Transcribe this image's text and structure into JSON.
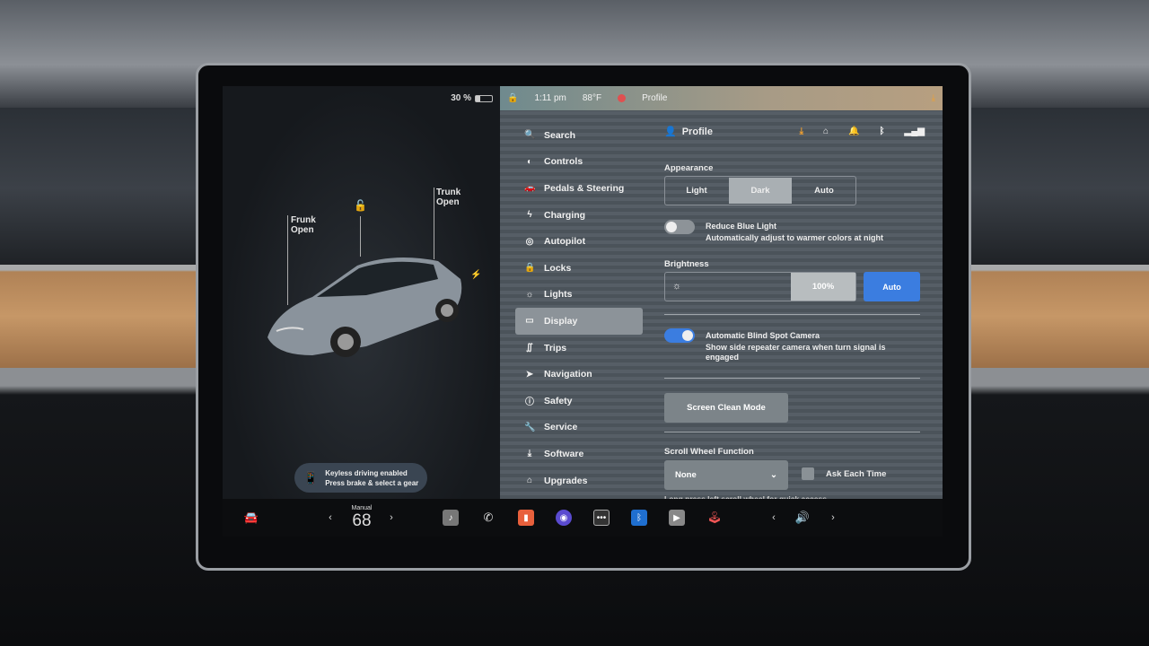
{
  "status": {
    "battery": "30 %",
    "battery_level": 30,
    "time": "1:11 pm",
    "temperature": "88°F",
    "profile": "Profile"
  },
  "car": {
    "frunk": "Frunk\nOpen",
    "trunk": "Trunk\nOpen"
  },
  "toast": {
    "title": "Keyless driving enabled",
    "subtitle": "Press brake & select a gear"
  },
  "menu": [
    {
      "label": "Search",
      "icon": "search-icon"
    },
    {
      "label": "Controls",
      "icon": "toggle-icon"
    },
    {
      "label": "Pedals & Steering",
      "icon": "car-icon"
    },
    {
      "label": "Charging",
      "icon": "bolt-icon"
    },
    {
      "label": "Autopilot",
      "icon": "steering-wheel-icon"
    },
    {
      "label": "Locks",
      "icon": "lock-icon"
    },
    {
      "label": "Lights",
      "icon": "sun-icon"
    },
    {
      "label": "Display",
      "icon": "display-icon",
      "selected": true
    },
    {
      "label": "Trips",
      "icon": "trips-icon"
    },
    {
      "label": "Navigation",
      "icon": "navigation-icon"
    },
    {
      "label": "Safety",
      "icon": "safety-icon"
    },
    {
      "label": "Service",
      "icon": "wrench-icon"
    },
    {
      "label": "Software",
      "icon": "download-icon"
    },
    {
      "label": "Upgrades",
      "icon": "bag-icon"
    }
  ],
  "header": {
    "profile": "Profile"
  },
  "display": {
    "appearance_label": "Appearance",
    "appearance_options": [
      "Light",
      "Dark",
      "Auto"
    ],
    "appearance_selected": "Dark",
    "reduce_blue_title": "Reduce Blue Light",
    "reduce_blue_desc": "Automatically adjust to warmer colors at night",
    "reduce_blue_on": false,
    "brightness_label": "Brightness",
    "brightness_value": "100%",
    "brightness_auto": "Auto",
    "blind_spot_title": "Automatic Blind Spot Camera",
    "blind_spot_desc": "Show side repeater camera when turn signal is engaged",
    "blind_spot_on": true,
    "screen_clean": "Screen Clean Mode",
    "scroll_label": "Scroll Wheel Function",
    "scroll_value": "None",
    "ask_each_time": "Ask Each Time",
    "scroll_hint": "Long press left scroll wheel for quick access"
  },
  "dock": {
    "climate_mode": "Manual",
    "temperature": "68"
  },
  "colors": {
    "accent": "#3b7de0",
    "download": "#f0a030"
  }
}
